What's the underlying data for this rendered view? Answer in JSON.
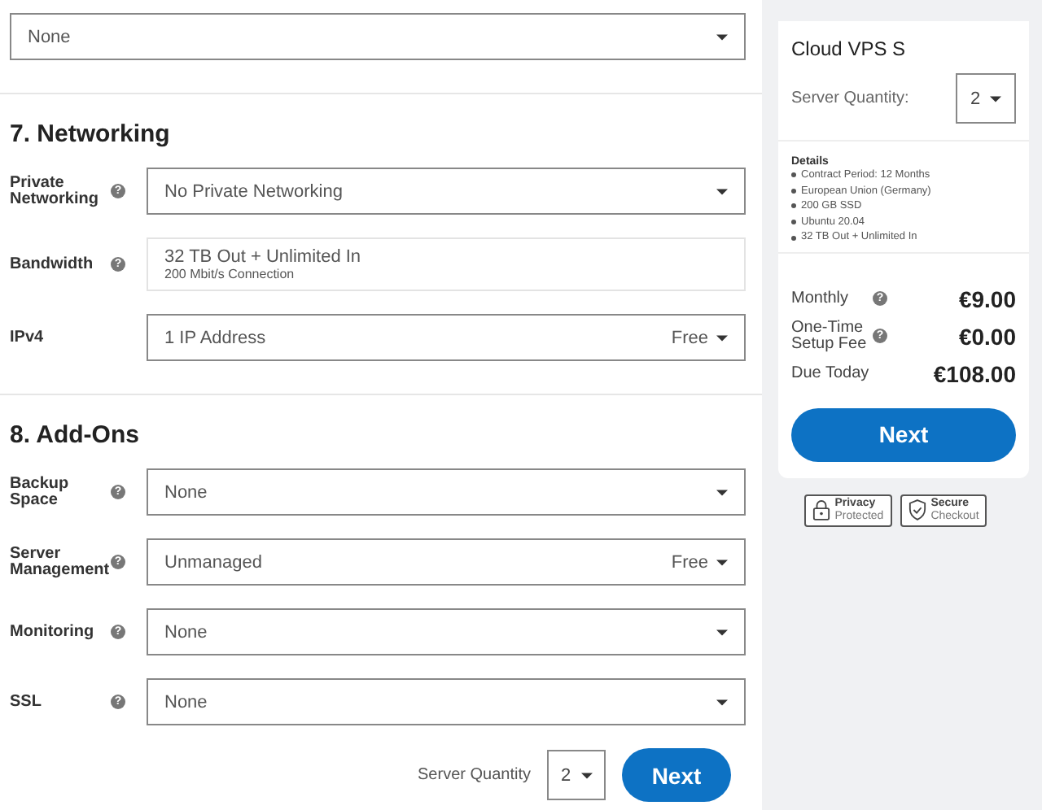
{
  "top_select": {
    "value": "None"
  },
  "sections": [
    {
      "title": "7. Networking",
      "fields": [
        {
          "kind": "select",
          "label": "Private Networking",
          "help": "?",
          "value": "No Private Networking"
        },
        {
          "kind": "static",
          "label": "Bandwidth",
          "help": "?",
          "value": "32 TB Out + Unlimited In",
          "sub": "200 Mbit/s Connection"
        },
        {
          "kind": "select",
          "label": "IPv4",
          "value": "1 IP Address",
          "price": "Free"
        }
      ]
    },
    {
      "title": "8. Add-Ons",
      "fields": [
        {
          "kind": "select",
          "label": "Backup Space",
          "help": "?",
          "value": "None"
        },
        {
          "kind": "select",
          "label": "Server Management",
          "help": "?",
          "value": "Unmanaged",
          "price": "Free"
        },
        {
          "kind": "select",
          "label": "Monitoring",
          "help": "?",
          "value": "None"
        },
        {
          "kind": "select",
          "label": "SSL",
          "help": "?",
          "value": "None"
        }
      ]
    }
  ],
  "footer": {
    "quantity_label": "Server Quantity",
    "quantity": "2",
    "next": "Next"
  },
  "summary": {
    "product": "Cloud VPS S",
    "quantity_label": "Server Quantity:",
    "quantity": "2",
    "details_title": "Details",
    "details": [
      "Contract Period: 12 Months",
      "European Union (Germany)",
      "200 GB SSD",
      "Ubuntu 20.04",
      "32 TB Out + Unlimited In"
    ],
    "totals": [
      {
        "label": "Monthly",
        "help": "?",
        "amount": "€9.00"
      },
      {
        "label": "One-Time Setup Fee",
        "help": "?",
        "amount": "€0.00"
      },
      {
        "label": "Due Today",
        "amount": "€108.00"
      }
    ],
    "next": "Next"
  },
  "badges": [
    {
      "kind": "lock",
      "title": "Privacy",
      "sub": "Protected"
    },
    {
      "kind": "shield",
      "title": "Secure",
      "sub": "Checkout"
    }
  ]
}
